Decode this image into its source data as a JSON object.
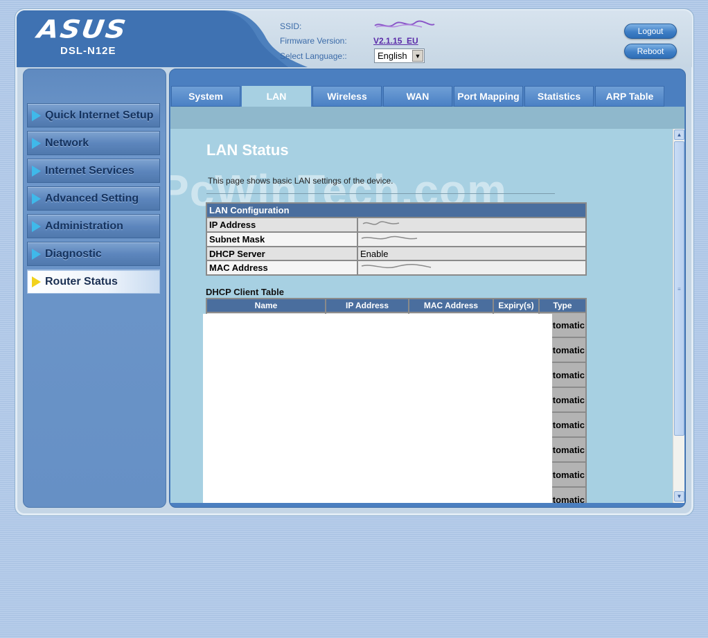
{
  "header": {
    "brand": "ASUS",
    "model": "DSL-N12E",
    "ssid_label": "SSID:",
    "firmware_label": "Firmware Version:",
    "firmware_value": "V2.1.15_EU",
    "language_label": "Select Language::",
    "language_value": "English",
    "logout_label": "Logout",
    "reboot_label": "Reboot"
  },
  "sidebar": {
    "items": [
      {
        "label": "Quick Internet Setup"
      },
      {
        "label": "Network"
      },
      {
        "label": "Internet Services"
      },
      {
        "label": "Advanced Setting"
      },
      {
        "label": "Administration"
      },
      {
        "label": "Diagnostic"
      },
      {
        "label": "Router Status",
        "active": true
      }
    ]
  },
  "tabs": [
    {
      "label": "System"
    },
    {
      "label": "LAN",
      "active": true
    },
    {
      "label": "Wireless"
    },
    {
      "label": "WAN"
    },
    {
      "label": "Port Mapping"
    },
    {
      "label": "Statistics"
    },
    {
      "label": "ARP Table"
    }
  ],
  "main": {
    "title": "LAN Status",
    "description": "This page shows basic LAN settings of the device.",
    "watermark": "PcWinTech.com",
    "lan_config": {
      "header": "LAN Configuration",
      "rows": [
        {
          "key": "IP Address",
          "value": ""
        },
        {
          "key": "Subnet Mask",
          "value": ""
        },
        {
          "key": "DHCP Server",
          "value": "Enable"
        },
        {
          "key": "MAC Address",
          "value": ""
        }
      ]
    },
    "dhcp": {
      "title": "DHCP Client Table",
      "columns": [
        "Name",
        "IP Address",
        "MAC Address",
        "Expiry(s)",
        "Type"
      ],
      "row_types": [
        "tomatic",
        "tomatic",
        "tomatic",
        "tomatic",
        "tomatic",
        "tomatic",
        "tomatic",
        "tomatic"
      ]
    }
  },
  "colors": {
    "accent": "#4b7fc0",
    "panel": "#a7d0e2",
    "table_header": "#4a6e9e"
  }
}
